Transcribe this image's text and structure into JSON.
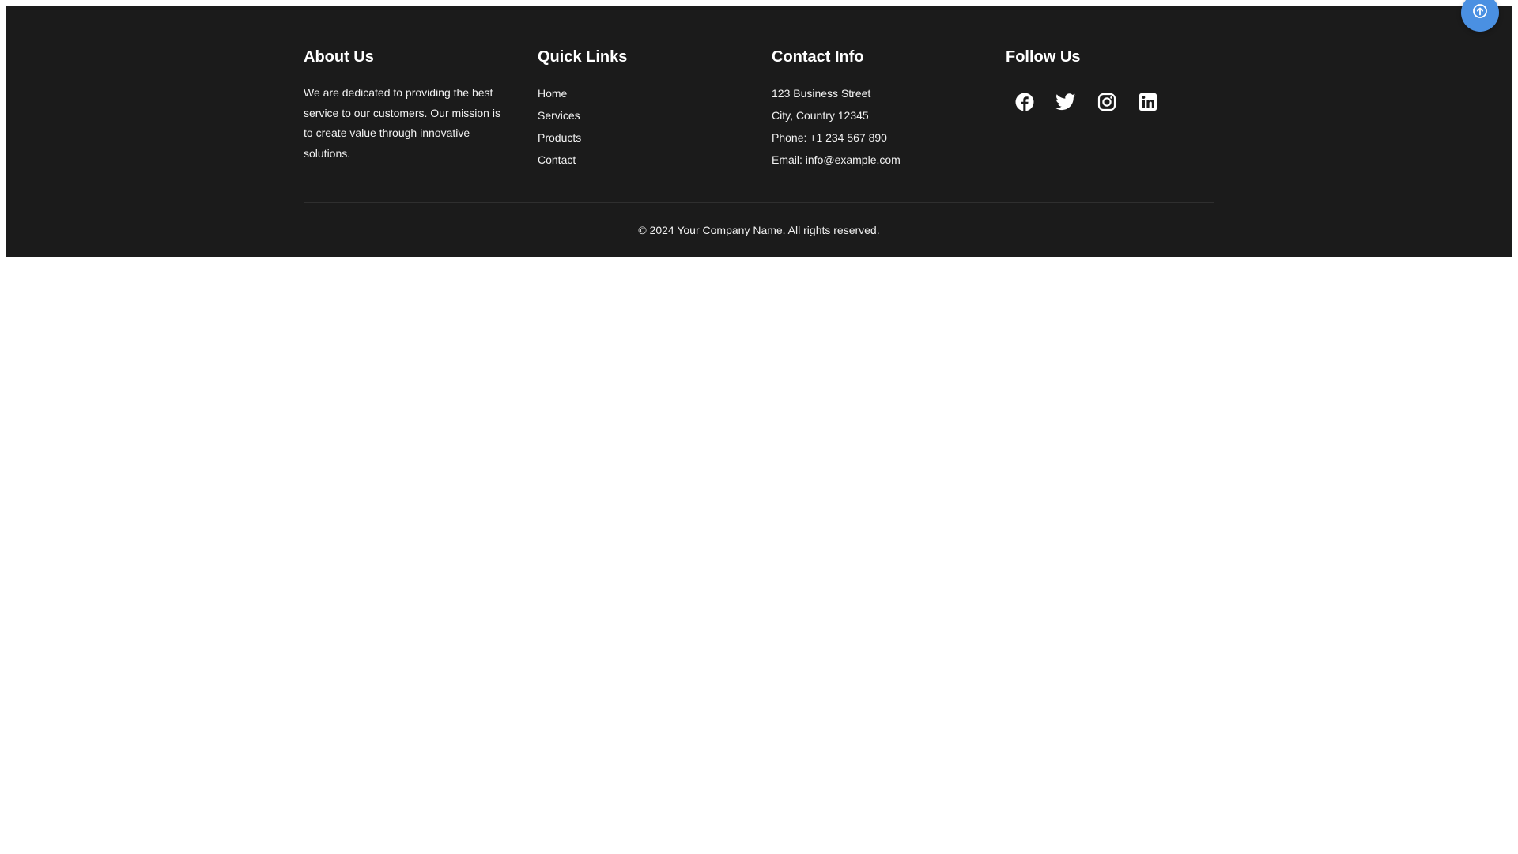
{
  "footer": {
    "about": {
      "heading": "About Us",
      "text": "We are dedicated to providing the best service to our customers. Our mission is to create value through innovative solutions."
    },
    "quick_links": {
      "heading": "Quick Links",
      "items": [
        {
          "label": "Home"
        },
        {
          "label": "Services"
        },
        {
          "label": "Products"
        },
        {
          "label": "Contact"
        }
      ]
    },
    "contact_info": {
      "heading": "Contact Info",
      "lines": [
        "123 Business Street",
        "City, Country 12345",
        "Phone: +1 234 567 890",
        "Email: info@example.com"
      ]
    },
    "follow": {
      "heading": "Follow Us",
      "icons": [
        "facebook-icon",
        "twitter-icon",
        "instagram-icon",
        "linkedin-icon"
      ]
    },
    "copyright": "© 2024 Your Company Name. All rights reserved."
  },
  "scroll_top": {
    "icon": "arrow-up-circle-icon"
  },
  "colors": {
    "footer_bg": "#1b1b1b",
    "text": "#ffffff",
    "accent": "#4a90e2"
  }
}
